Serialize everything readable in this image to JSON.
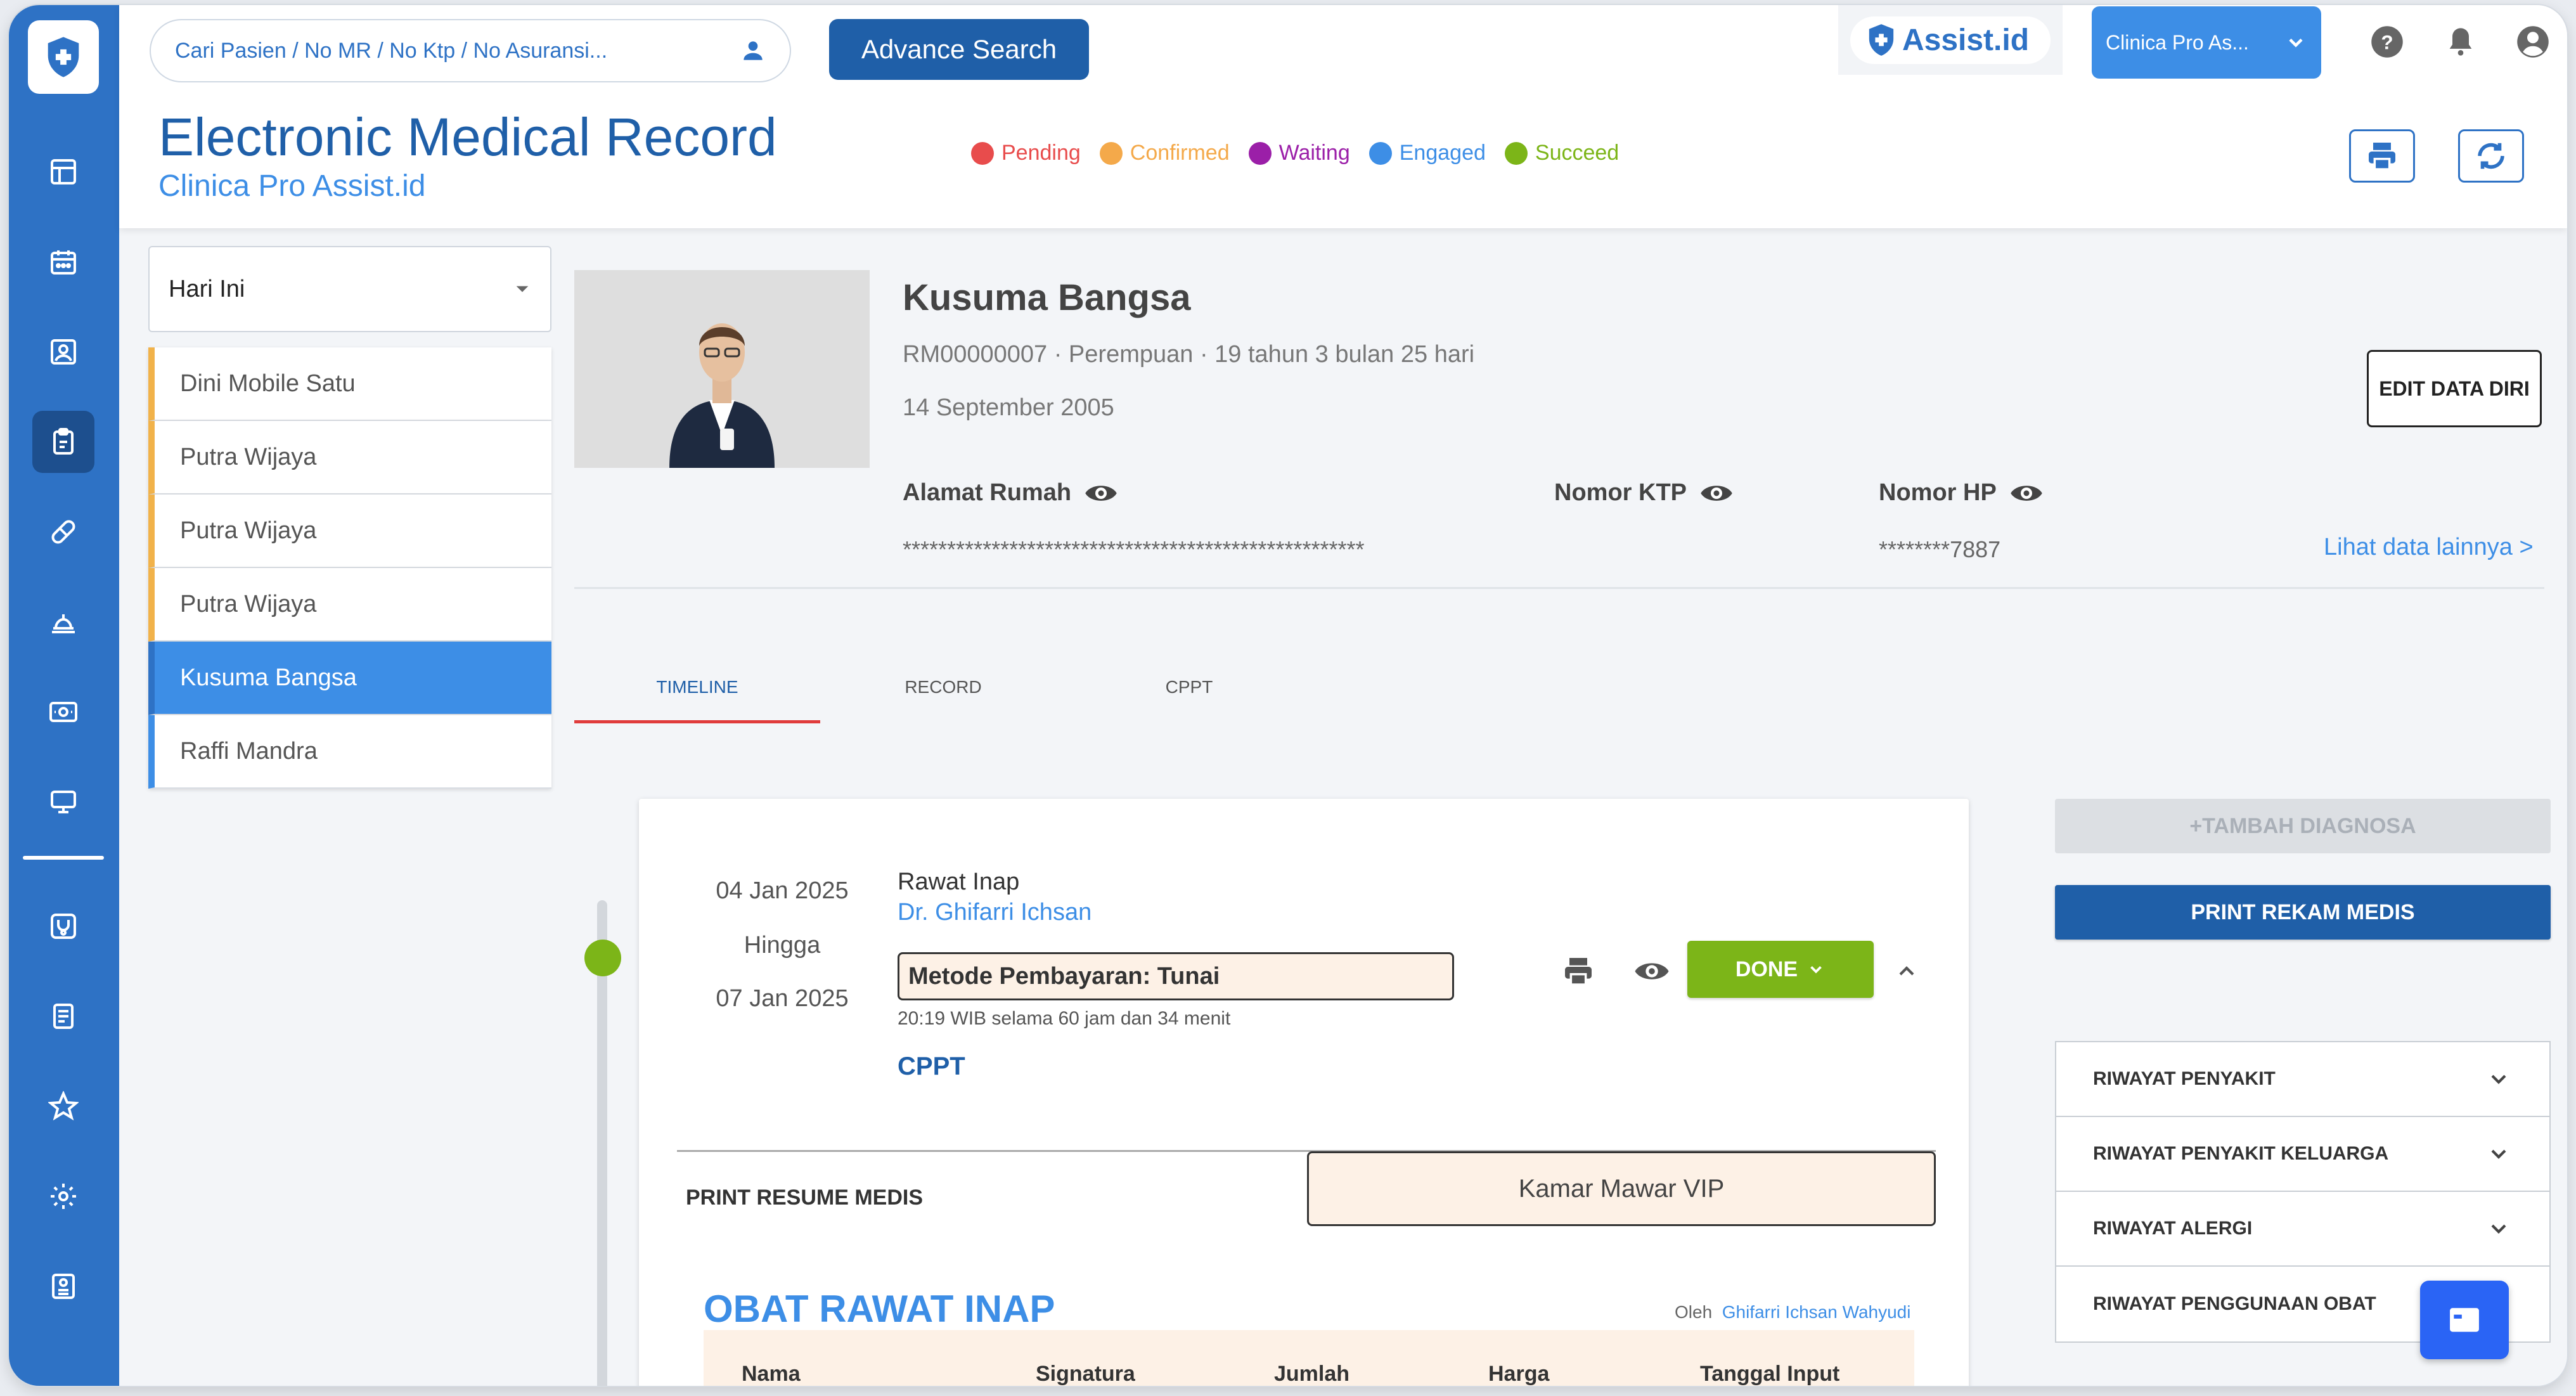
{
  "app": {
    "title": "Electronic Medical Record",
    "subtitle": "Clinica Pro Assist.id",
    "brand": "Assist.id",
    "clinic_selected": "Clinica Pro As..."
  },
  "search": {
    "placeholder": "Cari Pasien / No MR / No Ktp / No Asuransi...",
    "advance_label": "Advance Search"
  },
  "legend": [
    {
      "label": "Pending",
      "color": "#e84c4c"
    },
    {
      "label": "Confirmed",
      "color": "#f4a94a"
    },
    {
      "label": "Waiting",
      "color": "#9b1fa8"
    },
    {
      "label": "Engaged",
      "color": "#3d8ee6"
    },
    {
      "label": "Succeed",
      "color": "#7cb518"
    }
  ],
  "filter": {
    "selected": "Hari Ini"
  },
  "patients": [
    "Dini Mobile Satu",
    "Putra Wijaya",
    "Putra Wijaya",
    "Putra Wijaya",
    "Kusuma Bangsa",
    "Raffi Mandra"
  ],
  "patient": {
    "name": "Kusuma Bangsa",
    "meta": "RM00000007 · Perempuan · 19 tahun 3 bulan 25 hari",
    "dob": "14 September 2005",
    "edit_label": "EDIT DATA DIRI",
    "address_label": "Alamat Rumah",
    "address_value": "****************************************************",
    "ktp_label": "Nomor KTP",
    "hp_label": "Nomor HP",
    "hp_value": "********7887",
    "more_link": "Lihat data lainnya >"
  },
  "tabs": [
    "TIMELINE",
    "RECORD",
    "CPPT"
  ],
  "visit": {
    "start": "04 Jan 2025",
    "until": "Hingga",
    "end": "07 Jan 2025",
    "type": "Rawat Inap",
    "doctor": "Dr. Ghifarri Ichsan",
    "payment": "Metode Pembayaran: Tunai",
    "duration": "20:19 WIB selama 60 jam dan 34 menit",
    "cppt_link": "CPPT",
    "status": "DONE",
    "print_resume": "PRINT RESUME MEDIS",
    "room": "Kamar Mawar VIP"
  },
  "obat": {
    "title": "OBAT RAWAT INAP",
    "by_label": "Oleh",
    "by_name": "Ghifarri Ichsan Wahyudi",
    "columns": [
      "Nama",
      "Signatura",
      "Jumlah",
      "Harga",
      "Tanggal Input"
    ]
  },
  "actions": {
    "add_diagnosis": "+TAMBAH DIAGNOSA",
    "print_record": "PRINT REKAM MEDIS"
  },
  "history": [
    "RIWAYAT PENYAKIT",
    "RIWAYAT PENYAKIT KELUARGA",
    "RIWAYAT ALERGI",
    "RIWAYAT PENGGUNAAN OBAT"
  ]
}
